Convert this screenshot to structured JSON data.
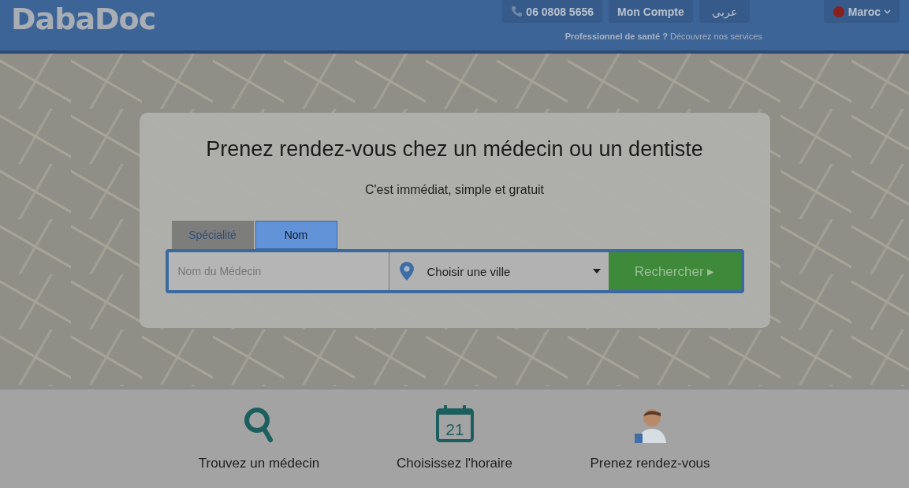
{
  "header": {
    "logo": "DabaDoc",
    "phone": "06 0808 5656",
    "account": "Mon Compte",
    "language": "عربي",
    "country": "Maroc",
    "pro_label": "Professionnel de santé ?",
    "pro_link": "Découvrez nos services"
  },
  "hero": {
    "title": "Prenez rendez-vous chez un médecin ou un dentiste",
    "subtitle": "C'est immédiat, simple et gratuit",
    "tabs": [
      {
        "label": "Spécialité",
        "selected": false
      },
      {
        "label": "Nom",
        "selected": true
      }
    ],
    "search": {
      "placeholder": "Nom du Médecin",
      "city": "Choisir une ville",
      "button": "Rechercher ▸"
    }
  },
  "steps": [
    {
      "kind": "search",
      "label": "Trouvez un médecin"
    },
    {
      "kind": "calendar",
      "day": "21",
      "label": "Choisissez l'horaire"
    },
    {
      "kind": "doctor",
      "label": "Prenez rendez-vous"
    }
  ]
}
